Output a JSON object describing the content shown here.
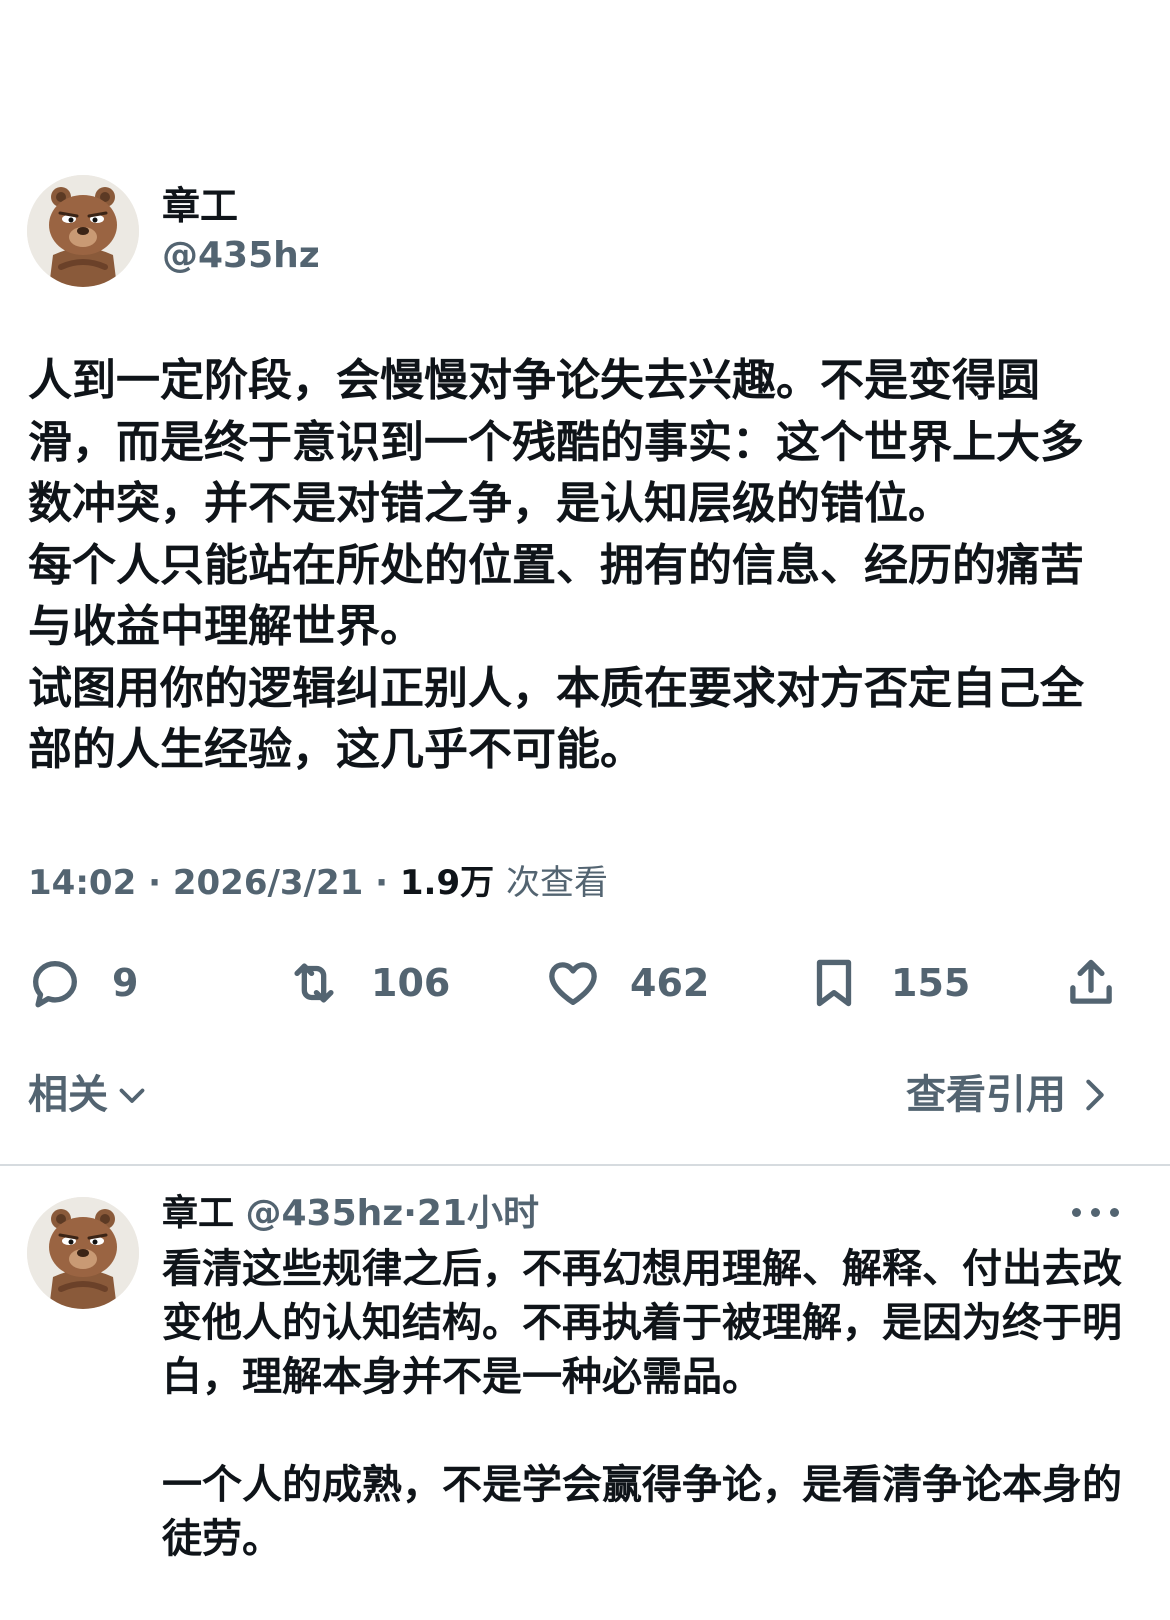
{
  "author": {
    "display_name": "章工",
    "handle": "@435hz",
    "avatar_icon": "bear-avatar-icon"
  },
  "tweet": {
    "paragraphs": [
      "人到一定阶段，会慢慢对争论失去兴趣。不是变得圆滑，而是终于意识到一个残酷的事实：这个世界上大多数冲突，并不是对错之争，是认知层级的错位。",
      "每个人只能站在所处的位置、拥有的信息、经历的痛苦与收益中理解世界。",
      "试图用你的逻辑纠正别人，本质在要求对方否定自己全部的人生经验，这几乎不可能。"
    ],
    "time": "14:02",
    "date": "2026/3/21",
    "views": "1.9万",
    "views_label": "次查看",
    "separator": "·"
  },
  "actions": {
    "reply": {
      "icon": "reply-icon",
      "count": "9"
    },
    "retweet": {
      "icon": "retweet-icon",
      "count": "106"
    },
    "like": {
      "icon": "heart-icon",
      "count": "462"
    },
    "bookmark": {
      "icon": "bookmark-icon",
      "count": "155"
    },
    "share": {
      "icon": "share-icon"
    }
  },
  "related": {
    "label": "相关",
    "icon": "chevron-down-icon"
  },
  "quotes": {
    "label": "查看引用",
    "icon": "chevron-right-icon"
  },
  "reply": {
    "display_name": "章工",
    "handle": "@435hz",
    "separator": "·",
    "time": "21小时",
    "more_icon": "more-icon",
    "paragraphs": [
      "看清这些规律之后，不再幻想用理解、解释、付出去改变他人的认知结构。不再执着于被理解，是因为终于明白，理解本身并不是一种必需品。",
      "一个人的成熟，不是学会赢得争论，是看清争论本身的徒劳。"
    ]
  },
  "colors": {
    "text_primary": "#0f1419",
    "text_secondary": "#536471",
    "divider": "#d6dbdf",
    "background": "#ffffff"
  }
}
